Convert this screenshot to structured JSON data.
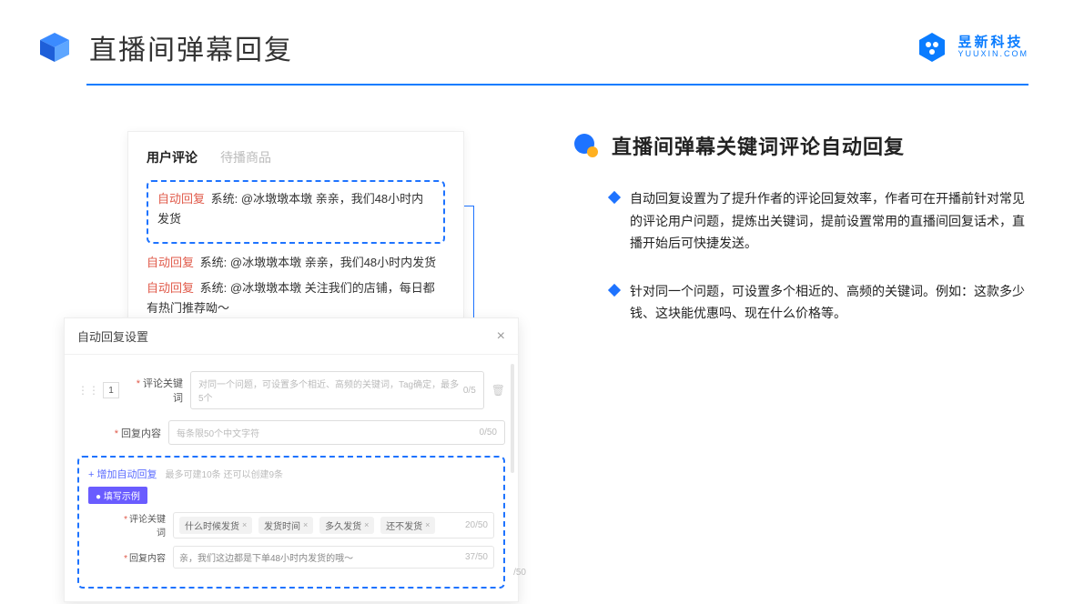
{
  "header": {
    "title": "直播间弹幕回复",
    "brand_cn": "昱新科技",
    "brand_en": "YUUXIN.COM"
  },
  "comments": {
    "tab_active": "用户评论",
    "tab_inactive": "待播商品",
    "auto_label": "自动回复",
    "sys_label": "系统:",
    "line1": "@冰墩墩本墩 亲亲，我们48小时内发货",
    "line2": "@冰墩墩本墩 亲亲，我们48小时内发货",
    "line3": "@冰墩墩本墩 关注我们的店铺，每日都有热门推荐呦～"
  },
  "settings": {
    "title": "自动回复设置",
    "idx": "1",
    "kw_label": "评论关键词",
    "kw_placeholder": "对同一个问题，可设置多个相近、高频的关键词，Tag确定，最多5个",
    "kw_count": "0/5",
    "content_label": "回复内容",
    "content_placeholder": "每条限50个中文字符",
    "content_count": "0/50",
    "add_text": "+ 增加自动回复",
    "add_note": "最多可建10条 还可以创建9条",
    "example_badge": "● 填写示例",
    "ex_kw_label": "评论关键词",
    "ex_tag1": "什么时候发货",
    "ex_tag2": "发货时间",
    "ex_tag3": "多久发货",
    "ex_tag4": "还不发货",
    "ex_kw_count": "20/50",
    "ex_content_label": "回复内容",
    "ex_content_value": "亲，我们这边都是下单48小时内发货的哦～",
    "ex_content_count": "37/50",
    "outside_count": "/50"
  },
  "right": {
    "section_title": "直播间弹幕关键词评论自动回复",
    "bullet1": "自动回复设置为了提升作者的评论回复效率，作者可在开播前针对常见的评论用户问题，提炼出关键词，提前设置常用的直播间回复话术，直播开始后可快捷发送。",
    "bullet2": "针对同一个问题，可设置多个相近的、高频的关键词。例如：这款多少钱、这块能优惠吗、现在什么价格等。"
  }
}
